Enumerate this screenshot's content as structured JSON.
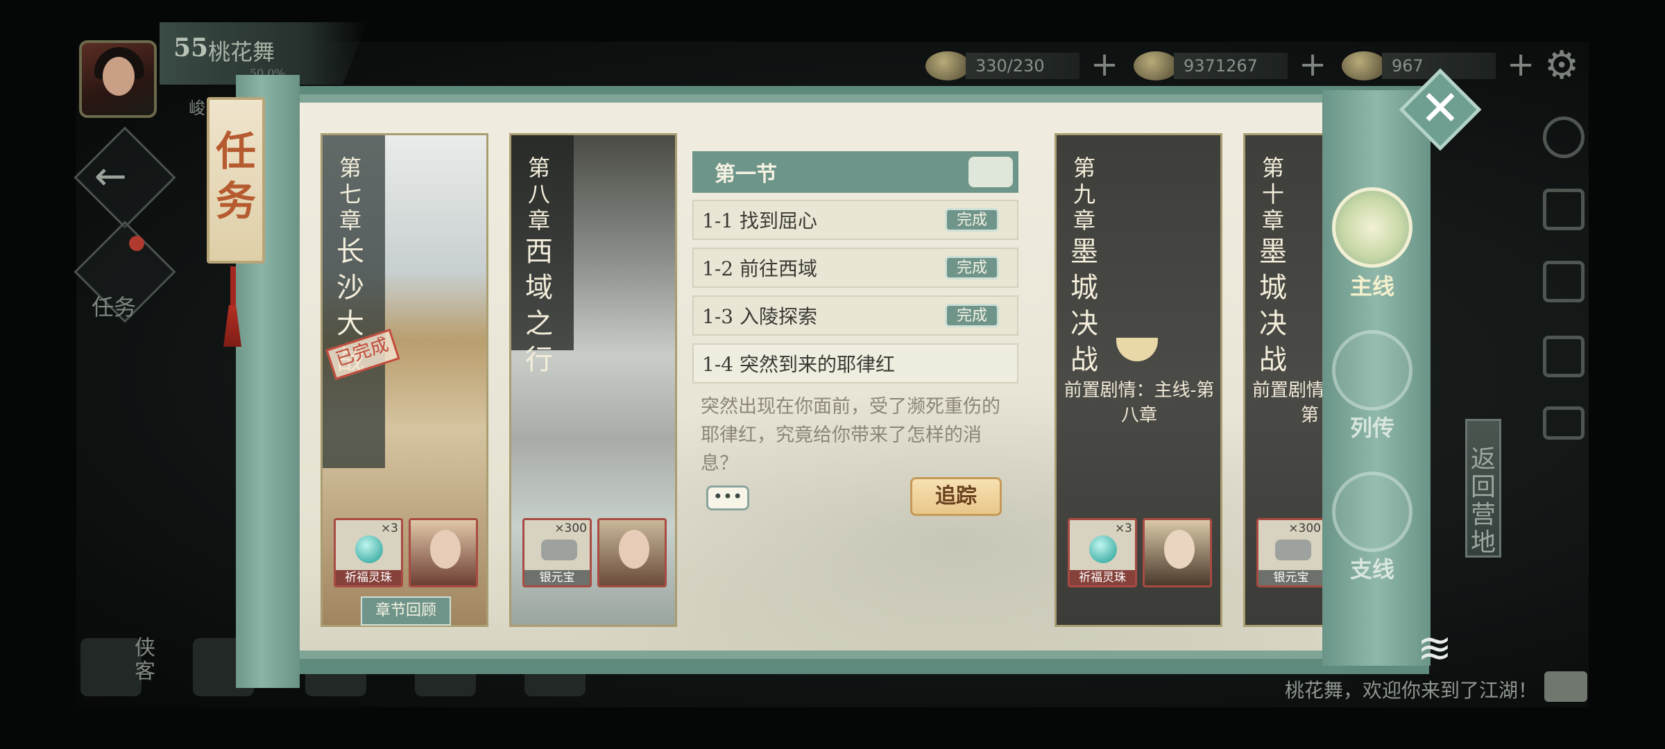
{
  "player": {
    "level": "55",
    "name": "桃花舞",
    "progress": "50.0%",
    "sub": "峻"
  },
  "resources": [
    {
      "icon": "stamina-icon",
      "value": "330/230",
      "plus": "+"
    },
    {
      "icon": "copper-coin-icon",
      "value": "9371267",
      "plus": "+"
    },
    {
      "icon": "gold-ingot-icon",
      "value": "967",
      "plus": "+"
    }
  ],
  "hud": {
    "back": "←",
    "task_label": "任务",
    "xiake": "侠客",
    "chat": "桃花舞，欢迎你来到了江湖！",
    "return_camp": "返回营地",
    "gear": "⚙"
  },
  "modal": {
    "title": "任务",
    "close": "✕",
    "tabs": [
      {
        "label": "主线"
      },
      {
        "label": "列传"
      },
      {
        "label": "支线"
      }
    ],
    "chapters": [
      {
        "num": "第七章",
        "name": "长沙大战",
        "stamp": "已完成",
        "rewards": [
          {
            "name": "祈福灵珠",
            "count": "×3"
          }
        ],
        "review": "章节回顾"
      },
      {
        "num": "第八章",
        "name": "西域之行",
        "rewards": [
          {
            "name": "银元宝",
            "count": "×300"
          }
        ]
      },
      {
        "num": "第九章",
        "name": "墨城决战",
        "pre": "前置剧情：主线-第八章",
        "rewards": [
          {
            "name": "祈福灵珠",
            "count": "×3"
          }
        ]
      },
      {
        "num": "第十章",
        "name": "墨城决战",
        "pre": "前置剧情",
        "pre2": "第",
        "rewards": [
          {
            "name": "银元宝",
            "count": "×300"
          }
        ]
      }
    ],
    "section": {
      "title": "第一节"
    },
    "quests": [
      {
        "name": "1-1 找到屈心",
        "status": "完成"
      },
      {
        "name": "1-2 前往西域",
        "status": "完成"
      },
      {
        "name": "1-3 入陵探索",
        "status": "完成"
      },
      {
        "name": "1-4 突然到来的耶律红",
        "status": ""
      }
    ],
    "desc": "突然出现在你面前，受了濒死重伤的耶律红，究竟给你带来了怎样的消息？",
    "dots": "•••",
    "track": "追踪"
  },
  "colors": {
    "accent": "#6f948a",
    "frame": "#7fa597",
    "paper": "#e9e6d6",
    "track": "#e9c68a",
    "stamp": "#c24a3b"
  }
}
